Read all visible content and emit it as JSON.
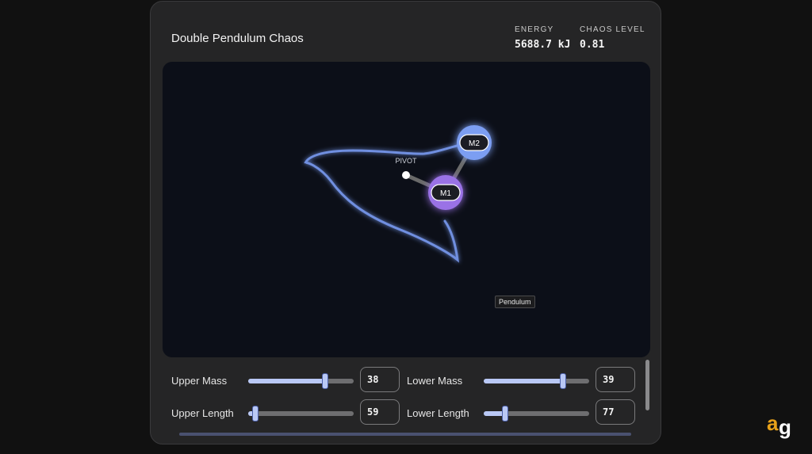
{
  "app": {
    "title": "Double Pendulum Chaos"
  },
  "stats": {
    "energy_label": "ENERGY",
    "energy_value": "5688.7 kJ",
    "chaos_label": "CHAOS LEVEL",
    "chaos_value": "0.81"
  },
  "canvas": {
    "pivot_label": "PIVOT",
    "mass1_label": "M1",
    "mass2_label": "M2",
    "tooltip": "Pendulum",
    "colors": {
      "background": "#0c0f18",
      "trail": "#6f8fe0",
      "mass1": "#9a72e6",
      "mass2": "#7c9ef2",
      "rod": "#6a6a6a"
    }
  },
  "controls": {
    "upper_mass": {
      "label": "Upper Mass",
      "value": "38",
      "fraction": 0.73
    },
    "lower_mass": {
      "label": "Lower Mass",
      "value": "39",
      "fraction": 0.75
    },
    "upper_length": {
      "label": "Upper Length",
      "value": "59",
      "fraction": 0.07
    },
    "lower_length": {
      "label": "Lower Length",
      "value": "77",
      "fraction": 0.2
    }
  },
  "logo": {
    "text": "ag",
    "icon": "ag-logo-icon"
  }
}
